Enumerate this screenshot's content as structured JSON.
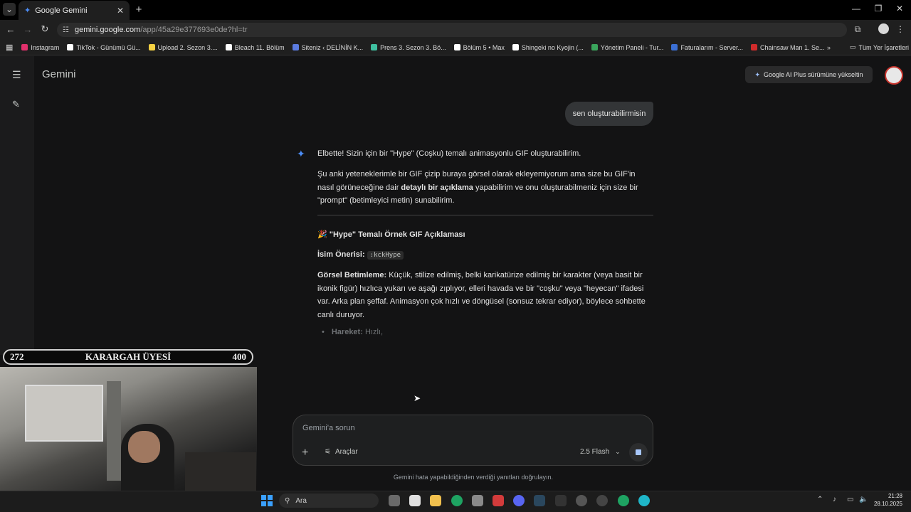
{
  "browser": {
    "tab_title": "Google Gemini",
    "url_host": "gemini.google.com",
    "url_path": "/app/45a29e377693e0de?hl=tr",
    "bookmarks": [
      {
        "label": "Instagram",
        "color": "#e1306c"
      },
      {
        "label": "TikTok - Günümü Gü...",
        "color": "#ffffff"
      },
      {
        "label": "Upload 2. Sezon 3....",
        "color": "#f5d142"
      },
      {
        "label": "Bleach 11. Bölüm",
        "color": "#ffffff"
      },
      {
        "label": "Siteniz ‹ DELİNİN K...",
        "color": "#5b7be0"
      },
      {
        "label": "Prens 3. Sezon 3. Bö...",
        "color": "#3fbfa0"
      },
      {
        "label": "Bölüm 5 • Max",
        "color": "#ffffff"
      },
      {
        "label": "Shingeki no Kyojin (...",
        "color": "#ffffff"
      },
      {
        "label": "Yönetim Paneli - Tur...",
        "color": "#3aa55c"
      },
      {
        "label": "Faturalarım - Server...",
        "color": "#3b6fd4"
      },
      {
        "label": "Chainsaw Man 1. Se...",
        "color": "#d02b2b"
      }
    ],
    "all_bookmarks": "Tüm Yer İşaretleri"
  },
  "app": {
    "brand": "Gemini",
    "upgrade_label": "Google AI Plus sürümüne yükseltin"
  },
  "chat": {
    "user_message": "sen oluşturabilirmisin",
    "p1": "Elbette! Sizin için bir \"Hype\" (Coşku) temalı animasyonlu GIF oluşturabilirim.",
    "p2_a": "Şu anki yeteneklerimle bir GIF çizip buraya görsel olarak ekleyemiyorum ama size bu GIF'in nasıl görüneceğine dair ",
    "p2_b": "detaylı bir açıklama",
    "p2_c": " yapabilirim ve onu oluşturabilmeniz için size bir \"prompt\" (betimleyici metin) sunabilirim.",
    "section_emoji": "🎉",
    "section_title": "\"Hype\" Temalı Örnek GIF Açıklaması",
    "name_label": "İsim Önerisi:",
    "name_code": ":kckHype",
    "desc_label": "Görsel Betimleme:",
    "desc_text": " Küçük, stilize edilmiş, belki karikatürize edilmiş bir karakter (veya basit bir ikonik figür) hızlıca yukarı ve aşağı zıplıyor, elleri havada ve bir \"coşku\" veya \"heyecan\" ifadesi var. Arka plan şeffaf. Animasyon çok hızlı ve döngüsel (sonsuz tekrar ediyor), böylece sohbette canlı duruyor.",
    "bullet_label": "Hareket:",
    "bullet_text": " Hızlı,"
  },
  "input": {
    "placeholder": "Gemini'a sorun",
    "tools_label": "Araçlar",
    "model_label": "2.5 Flash",
    "disclaimer": "Gemini hata yapabildiğinden verdiği yanıtları doğrulayın."
  },
  "overlay": {
    "left_value": "272",
    "title": "KARARGAH ÜYESİ",
    "right_value": "400"
  },
  "taskbar": {
    "search_label": "Ara",
    "time": "21:28",
    "date": "28.10.2025"
  }
}
